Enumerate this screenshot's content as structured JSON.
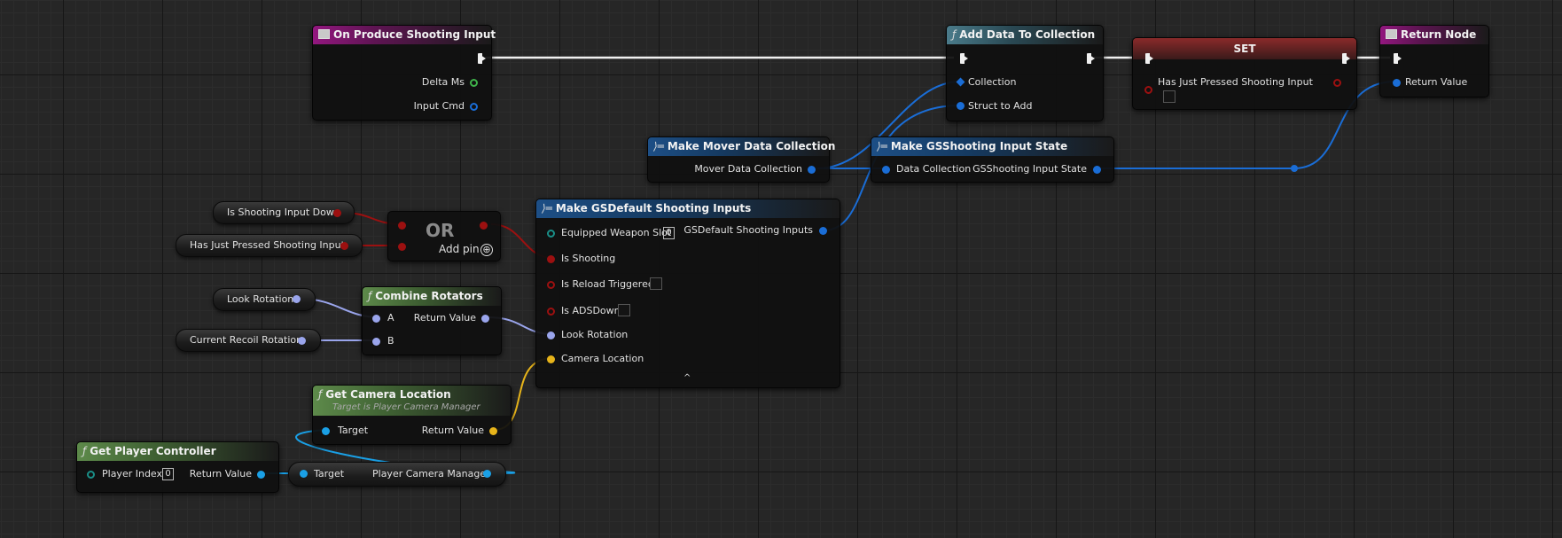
{
  "nodes": {
    "on_produce": {
      "title": "On Produce Shooting Input",
      "pins": [
        "Delta Ms",
        "Input Cmd"
      ]
    },
    "add_data": {
      "title": "Add Data To Collection",
      "pins": [
        "Collection",
        "Struct to Add"
      ]
    },
    "set": {
      "title": "SET",
      "pins": [
        "Has Just Pressed Shooting Input"
      ]
    },
    "return_node": {
      "title": "Return Node",
      "pins": [
        "Return Value"
      ]
    },
    "make_mover": {
      "title": "Make Mover Data Collection",
      "pins": [
        "Mover Data Collection"
      ]
    },
    "make_gsshooting": {
      "title": "Make GSShooting Input State",
      "pins": [
        "Data Collection",
        "GSShooting Input State"
      ]
    },
    "make_gsdefault": {
      "title": "Make GSDefault Shooting Inputs",
      "pins": [
        "Equipped Weapon Slot",
        "Is Shooting",
        "Is Reload Triggered",
        "Is ADSDown",
        "Look Rotation",
        "Camera Location",
        "GSDefault Shooting Inputs"
      ],
      "weapon_slot_value": "0"
    },
    "or_node": {
      "title": "OR",
      "add_pin": "Add pin"
    },
    "combine_rotators": {
      "title": "Combine Rotators",
      "pins": [
        "A",
        "B",
        "Return Value"
      ]
    },
    "get_camera_location": {
      "title": "Get Camera Location",
      "subtitle": "Target is Player Camera Manager",
      "pins": [
        "Target",
        "Return Value"
      ]
    },
    "get_player_controller": {
      "title": "Get Player Controller",
      "pins": [
        "Player Index",
        "Return Value"
      ],
      "player_index_value": "0"
    },
    "player_camera_manager": {
      "pins": [
        "Target",
        "Player Camera Manager"
      ]
    }
  },
  "variables": {
    "is_shooting_input_down": "Is Shooting Input Down",
    "has_just_pressed": "Has Just Pressed Shooting Input",
    "look_rotation": "Look Rotation",
    "current_recoil_rotation": "Current Recoil Rotation"
  },
  "icons": {
    "function": "ƒ",
    "make_struct": "make-struct-icon",
    "event": "event-icon",
    "add_pin": "⊕",
    "collapse": "^"
  },
  "colors": {
    "exec_wire": "#f0f0f0",
    "struct_wire": "#1a6dd6",
    "bool_wire": "#9c1010",
    "rotator_wire": "#9aa5ec",
    "vector_wire": "#e7b41a",
    "object_wire": "#1aa0e6"
  }
}
